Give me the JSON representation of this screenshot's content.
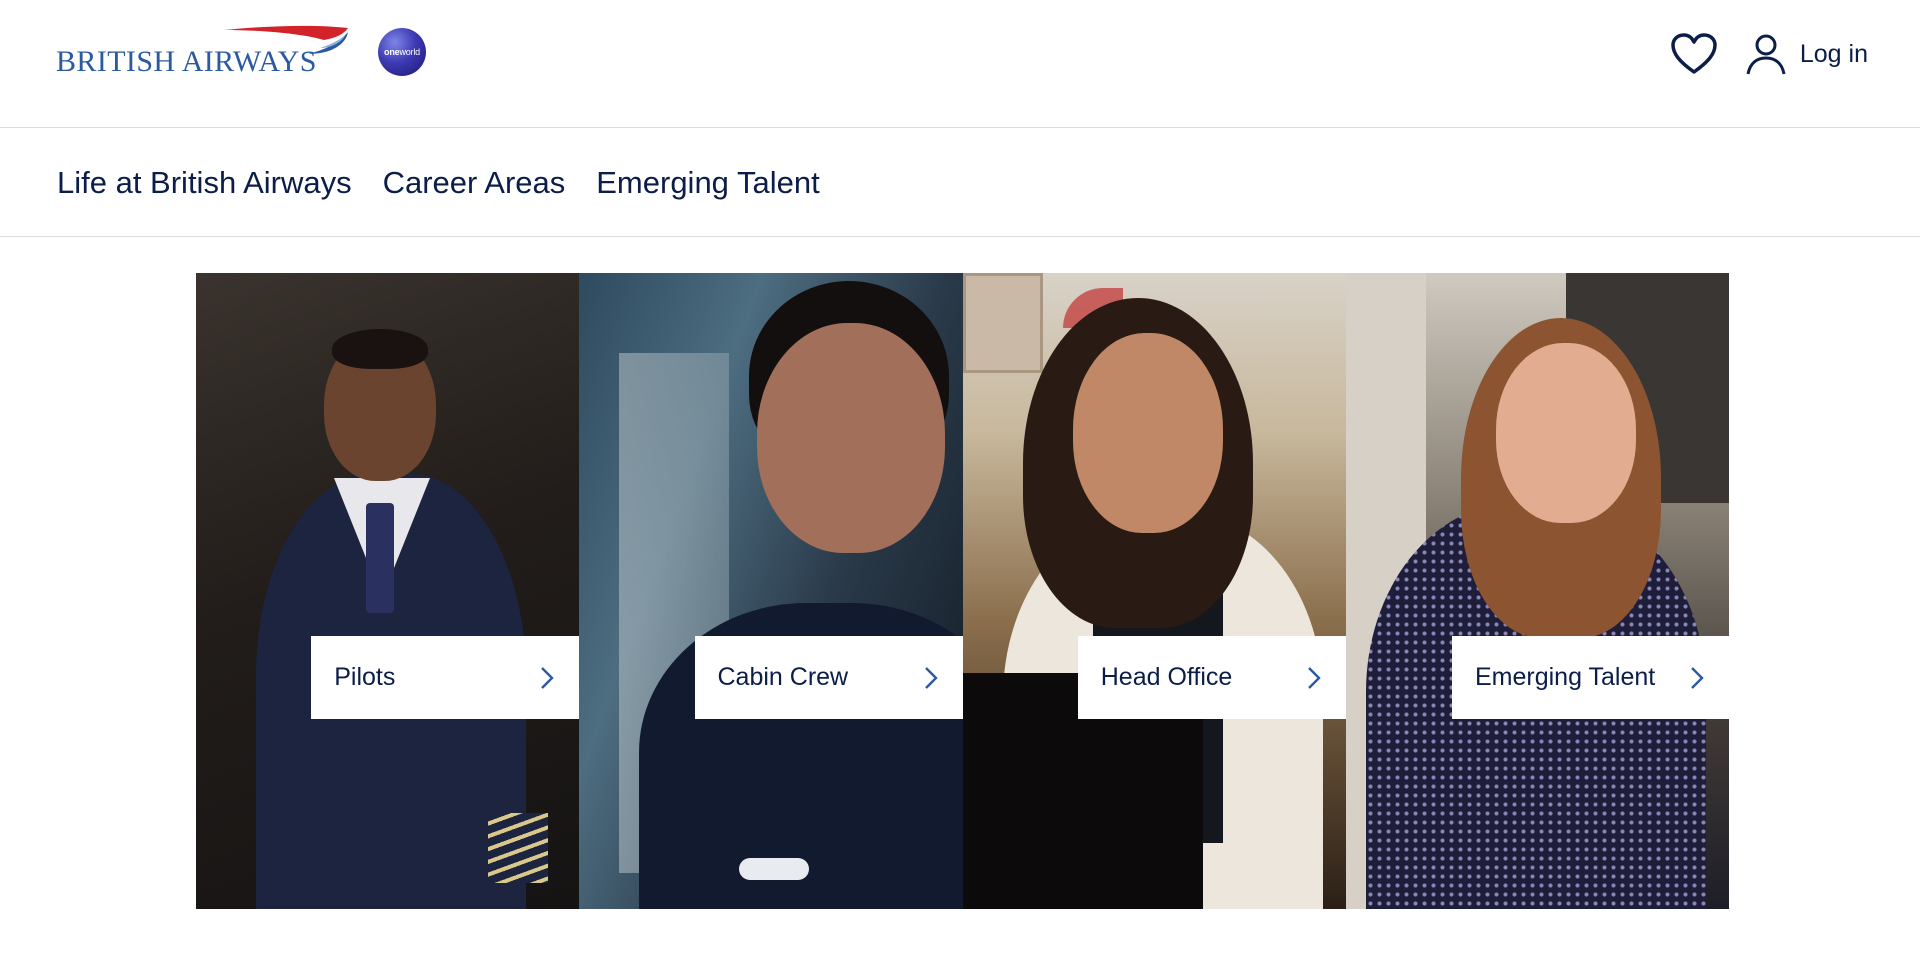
{
  "header": {
    "brand": "BRITISH AIRWAYS",
    "oneworld": {
      "one": "one",
      "world": "world"
    },
    "login_label": "Log in",
    "icons": [
      "heart-icon",
      "user-icon"
    ]
  },
  "nav": {
    "items": [
      {
        "label": "Life at British Airways"
      },
      {
        "label": "Career Areas"
      },
      {
        "label": "Emerging Talent"
      }
    ]
  },
  "cards": [
    {
      "label": "Pilots"
    },
    {
      "label": "Cabin Crew"
    },
    {
      "label": "Head Office"
    },
    {
      "label": "Emerging Talent"
    }
  ],
  "colors": {
    "navy_text": "#0b1d48",
    "brand_blue": "#2b5aa0",
    "brand_red": "#d2232a",
    "divider": "#dcdcdc"
  }
}
